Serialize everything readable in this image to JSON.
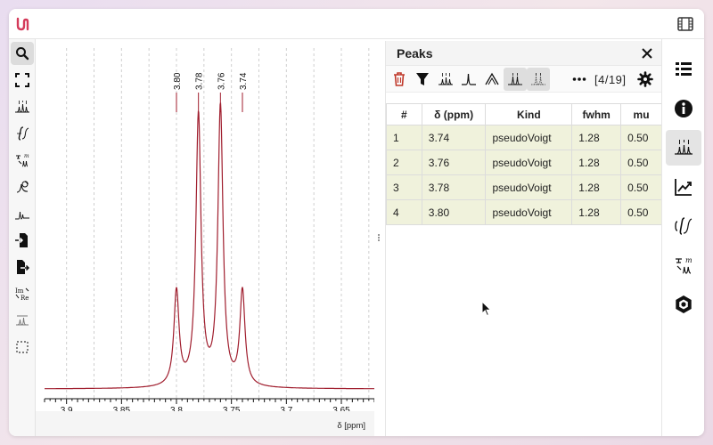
{
  "colors": {
    "spectrum_line": "#a01e2e",
    "row_bg": "#f0f2dc",
    "brand": "#d43a5a",
    "accent_icon": "#c0392b"
  },
  "left_toolbar": {
    "icons": [
      "search-icon",
      "fullscreen-icon",
      "peak-picking-icon",
      "integral-icon",
      "multiplet-icon",
      "phase-icon",
      "baseline-icon",
      "import-icon",
      "export-icon",
      "real-imag-icon",
      "exclusion-icon",
      "select-icon"
    ]
  },
  "panel": {
    "title": "Peaks",
    "counter": "[4/19]",
    "columns": [
      "#",
      "δ (ppm)",
      "Kind",
      "fwhm",
      "mu"
    ],
    "rows": [
      {
        "index": "1",
        "delta": "3.74",
        "kind": "pseudoVoigt",
        "fwhm": "1.28",
        "mu": "0.50"
      },
      {
        "index": "2",
        "delta": "3.76",
        "kind": "pseudoVoigt",
        "fwhm": "1.28",
        "mu": "0.50"
      },
      {
        "index": "3",
        "delta": "3.78",
        "kind": "pseudoVoigt",
        "fwhm": "1.28",
        "mu": "0.50"
      },
      {
        "index": "4",
        "delta": "3.80",
        "kind": "pseudoVoigt",
        "fwhm": "1.28",
        "mu": "0.50"
      }
    ]
  },
  "right_toolbar": {
    "icons": [
      "spectra-list-icon",
      "info-icon",
      "peaks-icon",
      "chart-icon",
      "integrals-icon",
      "multiplets-icon",
      "settings-hex-icon"
    ]
  },
  "chart_data": {
    "type": "line",
    "xlabel": "δ [ppm]",
    "xlim": [
      3.92,
      3.62
    ],
    "reversed_x": true,
    "x_ticks": [
      "3.9",
      "3.85",
      "3.8",
      "3.75",
      "3.7",
      "3.65"
    ],
    "peak_labels": [
      "3.80",
      "3.78",
      "3.76",
      "3.74"
    ],
    "peaks": [
      {
        "x": 3.8,
        "height": 0.34
      },
      {
        "x": 3.78,
        "height": 0.97
      },
      {
        "x": 3.76,
        "height": 1.0
      },
      {
        "x": 3.74,
        "height": 0.34
      }
    ],
    "grid": true
  }
}
